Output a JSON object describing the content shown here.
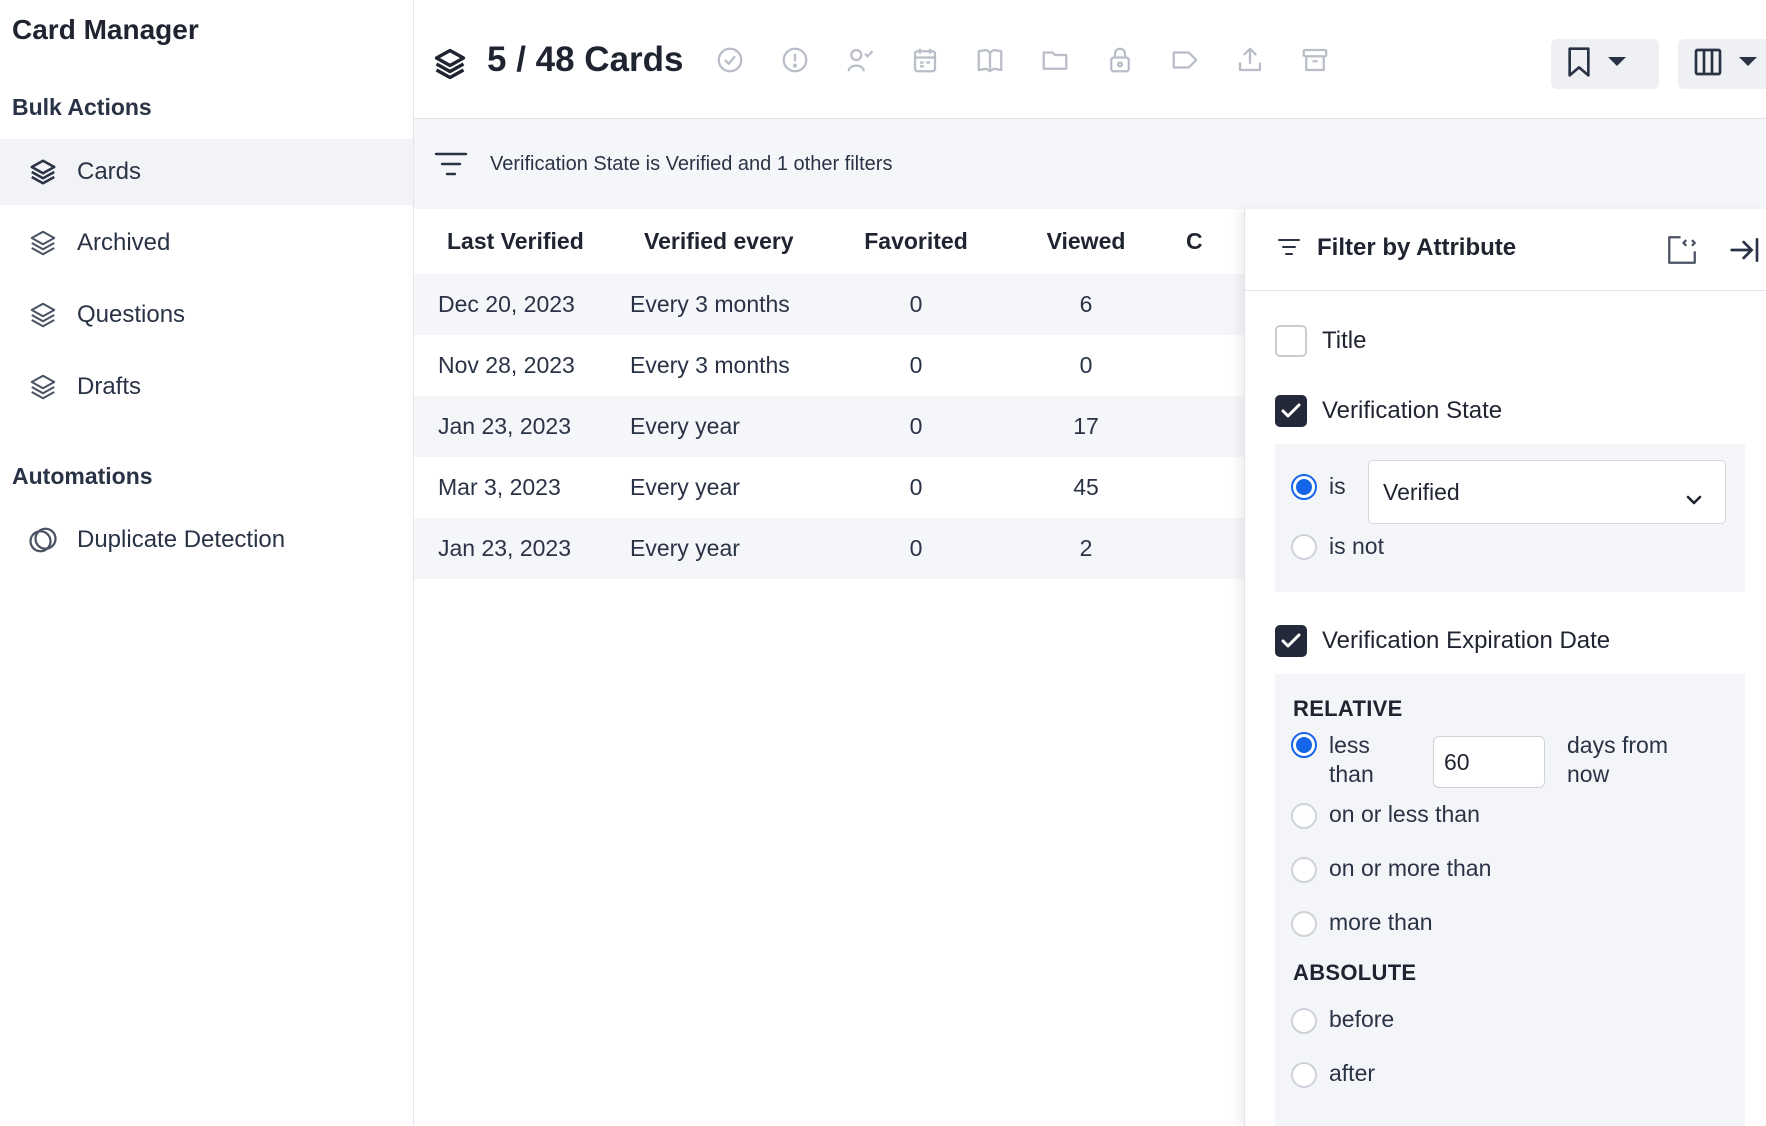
{
  "sidebar": {
    "app_title": "Card Manager",
    "bulk_actions_title": "Bulk Actions",
    "items": [
      {
        "label": "Cards",
        "icon": "layers-icon",
        "active": true
      },
      {
        "label": "Archived",
        "icon": "layers-icon"
      },
      {
        "label": "Questions",
        "icon": "layers-icon"
      },
      {
        "label": "Drafts",
        "icon": "layers-icon"
      }
    ],
    "automations_title": "Automations",
    "automations": [
      {
        "label": "Duplicate Detection",
        "icon": "overlap-circles-icon"
      }
    ]
  },
  "header": {
    "count": "5 / 48 Cards",
    "toolbar_icons": [
      "verify-icon",
      "alert-icon",
      "assign-user-icon",
      "calendar-icon",
      "book-icon",
      "folder-icon",
      "lock-icon",
      "tag-icon",
      "export-icon",
      "archive-icon"
    ],
    "bookmark_icon": "bookmark-icon",
    "columns_icon": "columns-icon"
  },
  "filter_bar": {
    "text": "Verification State is Verified and 1 other filters"
  },
  "table": {
    "headers": [
      "Last Verified",
      "Verified every",
      "Favorited",
      "Viewed",
      "C"
    ],
    "rows": [
      [
        "Dec 20, 2023",
        "Every 3 months",
        "0",
        "6"
      ],
      [
        "Nov 28, 2023",
        "Every 3 months",
        "0",
        "0"
      ],
      [
        "Jan 23, 2023",
        "Every year",
        "0",
        "17"
      ],
      [
        "Mar 3, 2023",
        "Every year",
        "0",
        "45"
      ],
      [
        "Jan 23, 2023",
        "Every year",
        "0",
        "2"
      ]
    ]
  },
  "panel": {
    "title": "Filter by Attribute",
    "title_filter": {
      "label": "Title",
      "checked": false
    },
    "verification_state": {
      "label": "Verification State",
      "checked": true,
      "is_label": "is",
      "is_not_label": "is not",
      "selected": "Verified"
    },
    "expiration": {
      "label": "Verification Expiration Date",
      "checked": true,
      "relative_heading": "RELATIVE",
      "less_than_1": "less",
      "less_than_2": "than",
      "days_value": "60",
      "days_suffix_1": "days from",
      "days_suffix_2": "now",
      "on_or_less": "on or less than",
      "on_or_more": "on or more than",
      "more_than": "more than",
      "absolute_heading": "ABSOLUTE",
      "before": "before",
      "after": "after"
    }
  },
  "colors": {
    "accent": "#1565e8",
    "check_dark": "#232938",
    "row_alt": "#f5f6f9"
  }
}
